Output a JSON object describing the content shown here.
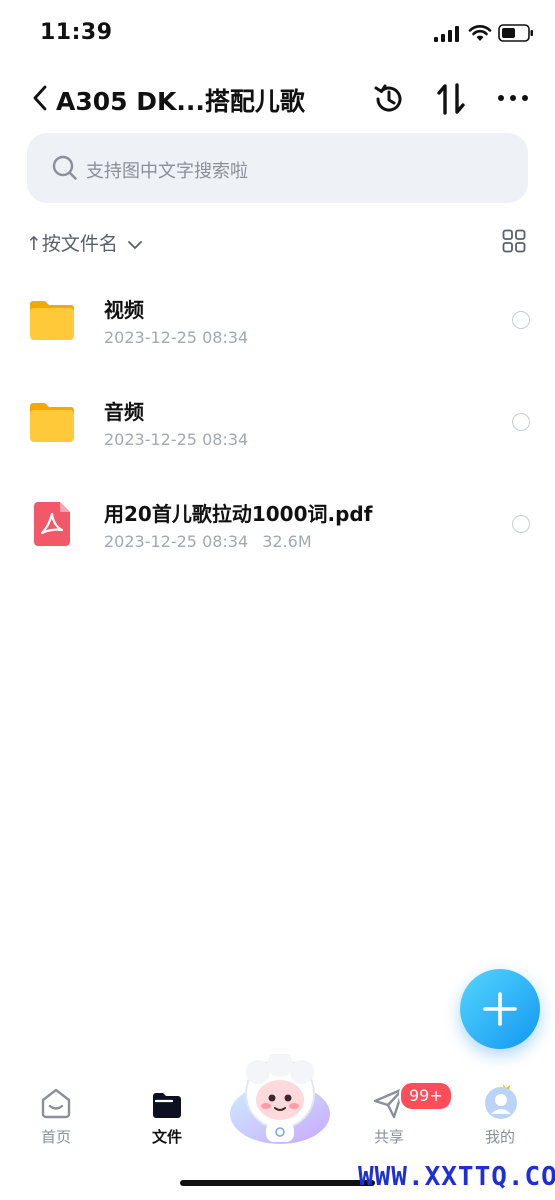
{
  "status": {
    "time": "11:39"
  },
  "nav": {
    "title": "A305 DK...搭配儿歌"
  },
  "search": {
    "placeholder": "支持图中文字搜索啦"
  },
  "sort": {
    "label": "按文件名"
  },
  "files": [
    {
      "name": "视频",
      "date": "2023-12-25 08:34",
      "size": "",
      "type": "folder-icon"
    },
    {
      "name": "音频",
      "date": "2023-12-25 08:34",
      "size": "",
      "type": "folder-icon"
    },
    {
      "name": "用20首儿歌拉动1000词.pdf",
      "date": "2023-12-25 08:34",
      "size": "32.6M",
      "type": "pdf-icon"
    }
  ],
  "tabs": [
    {
      "label": "首页",
      "icon": "home-icon"
    },
    {
      "label": "文件",
      "icon": "folder-tab-icon"
    },
    {
      "label": "共享",
      "icon": "send-icon",
      "badge": "99+"
    },
    {
      "label": "我的",
      "icon": "profile-icon"
    }
  ],
  "watermark": "WWW.XXTTQ.COM",
  "colors": {
    "accent": "#1296f0",
    "badge": "#ff4d5a",
    "folder": "#ffc21a",
    "pdf": "#f25868"
  }
}
